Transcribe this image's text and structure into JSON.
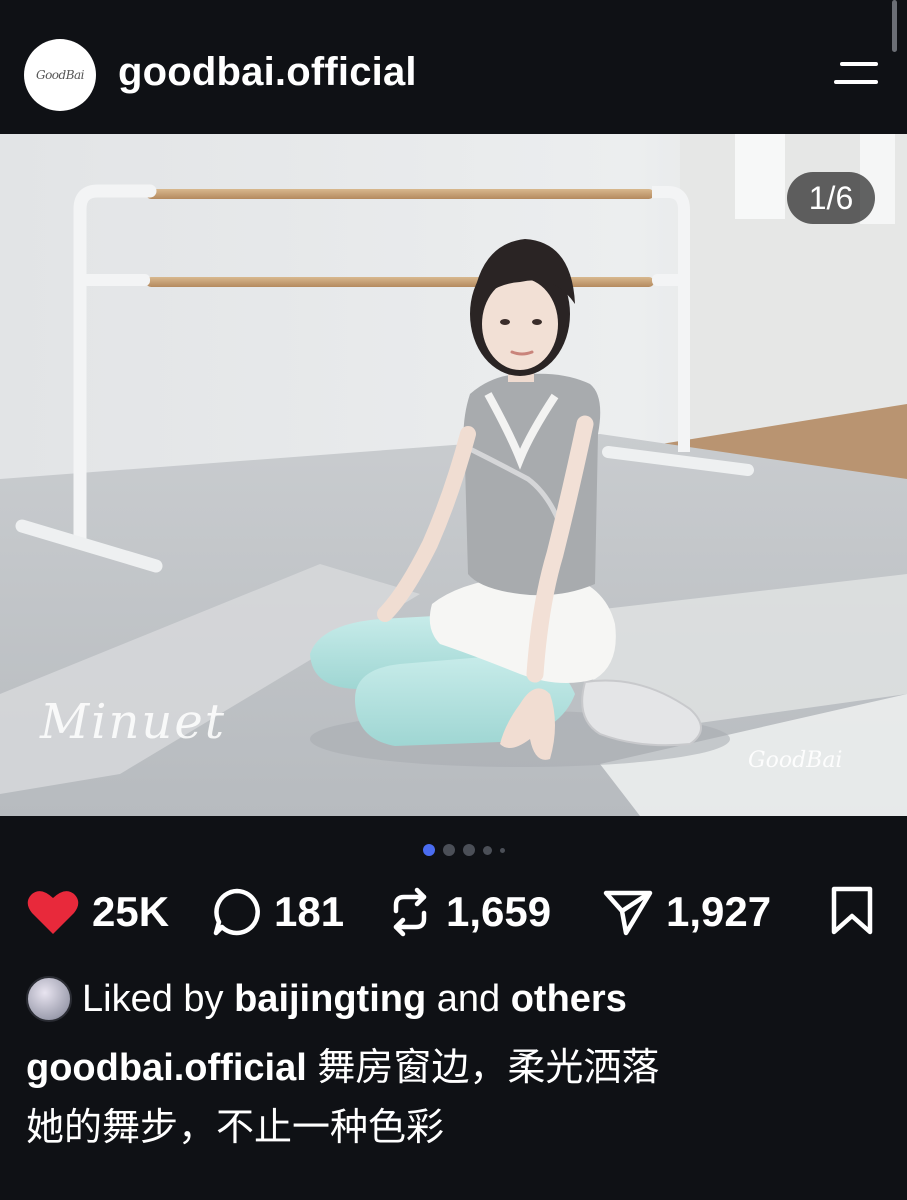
{
  "header": {
    "avatar_logo_text": "GoodBai",
    "username": "goodbai.official",
    "menu_icon": "menu-icon"
  },
  "post": {
    "image_counter": "1/6",
    "image_overlay_script": "Minuet",
    "image_watermark": "GoodBai",
    "carousel_dots": 5,
    "carousel_active_index": 0
  },
  "actions": {
    "likes": "25K",
    "comments": "181",
    "reposts": "1,659",
    "shares": "1,927",
    "like_color": "#e8293b"
  },
  "caption": {
    "liked_prefix": "Liked by ",
    "liked_user": "baijingting",
    "liked_middle": " and ",
    "liked_suffix": "others",
    "author": "goodbai.official",
    "line1": " 舞房窗边，柔光洒落",
    "line2": "她的舞步，不止一种色彩"
  }
}
